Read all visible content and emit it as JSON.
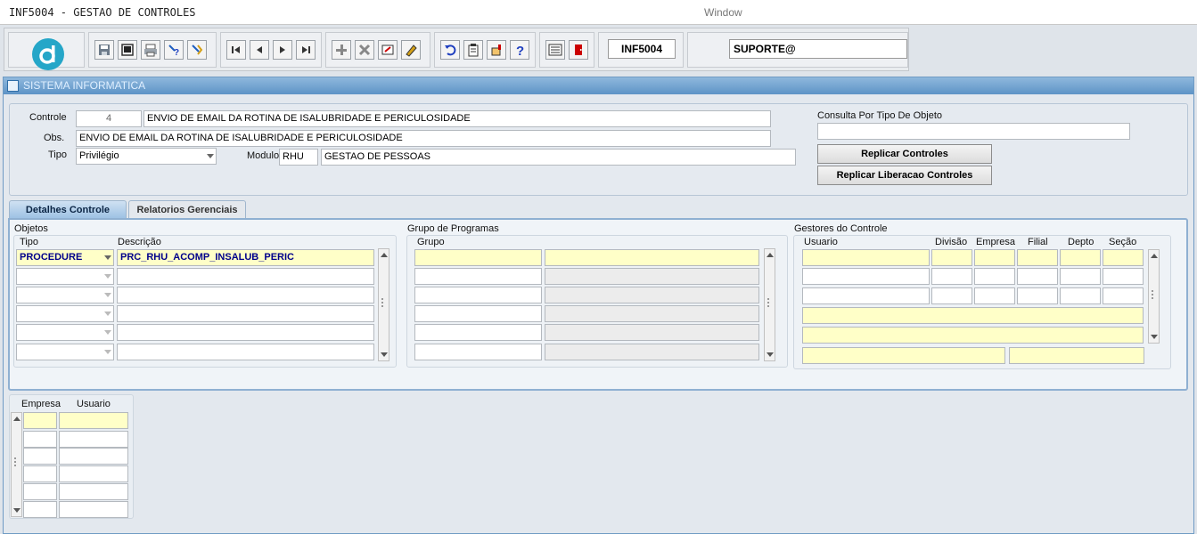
{
  "titlebar": {
    "app_title": "INF5004 - GESTAO DE CONTROLES",
    "window_label": "Window"
  },
  "toolbar": {
    "form_name": "INF5004",
    "user_name": "SUPORTE@",
    "icons": [
      "save-icon",
      "print-preview-icon",
      "print-icon",
      "help-query-icon",
      "execute-query-icon",
      "first-record-icon",
      "previous-record-icon",
      "next-record-icon",
      "last-record-icon",
      "insert-record-icon",
      "delete-record-icon",
      "clear-form-icon",
      "edit-icon",
      "undo-icon",
      "clipboard-icon",
      "hand-pointer-icon",
      "help-icon",
      "menu-icon",
      "exit-icon"
    ]
  },
  "window": {
    "title": "SISTEMA INFORMATICA"
  },
  "header": {
    "controle_label": "Controle",
    "controle_id": "4",
    "controle_name": "ENVIO DE EMAIL DA ROTINA DE ISALUBRIDADE E PERICULOSIDADE",
    "obs_label": "Obs.",
    "obs_value": "ENVIO DE EMAIL DA ROTINA DE ISALUBRIDADE E PERICULOSIDADE",
    "tipo_label": "Tipo",
    "tipo_value": "Privilégio",
    "modulo_label": "Modulo",
    "modulo_code": "RHU",
    "modulo_name": "GESTAO DE PESSOAS",
    "consulta_label": "Consulta Por Tipo De Objeto",
    "consulta_value": "",
    "replicar_controles": "Replicar Controles",
    "replicar_liberacao": "Replicar Liberacao Controles"
  },
  "tabs": [
    {
      "label": "Detalhes Controle",
      "active": true
    },
    {
      "label": "Relatorios Gerenciais",
      "active": false
    }
  ],
  "objetos": {
    "title": "Objetos",
    "col_tipo": "Tipo",
    "col_descricao": "Descrição",
    "rows": [
      {
        "tipo": "PROCEDURE",
        "descricao": "PRC_RHU_ACOMP_INSALUB_PERIC"
      },
      {
        "tipo": "",
        "descricao": ""
      },
      {
        "tipo": "",
        "descricao": ""
      },
      {
        "tipo": "",
        "descricao": ""
      },
      {
        "tipo": "",
        "descricao": ""
      },
      {
        "tipo": "",
        "descricao": ""
      }
    ]
  },
  "grupo": {
    "title": "Grupo de Programas",
    "col_grupo": "Grupo",
    "rows": [
      "",
      "",
      "",
      "",
      "",
      ""
    ]
  },
  "gestores": {
    "title": "Gestores do Controle",
    "cols": {
      "usuario": "Usuario",
      "divisao": "Divisão",
      "empresa": "Empresa",
      "filial": "Filial",
      "depto": "Depto",
      "secao": "Seção"
    }
  },
  "acesso": {
    "col_empresa": "Empresa",
    "col_usuario": "Usuario"
  },
  "colors": {
    "highlight": "#ffffc8",
    "accent": "#5d93c6",
    "required_label": "#e00000"
  }
}
